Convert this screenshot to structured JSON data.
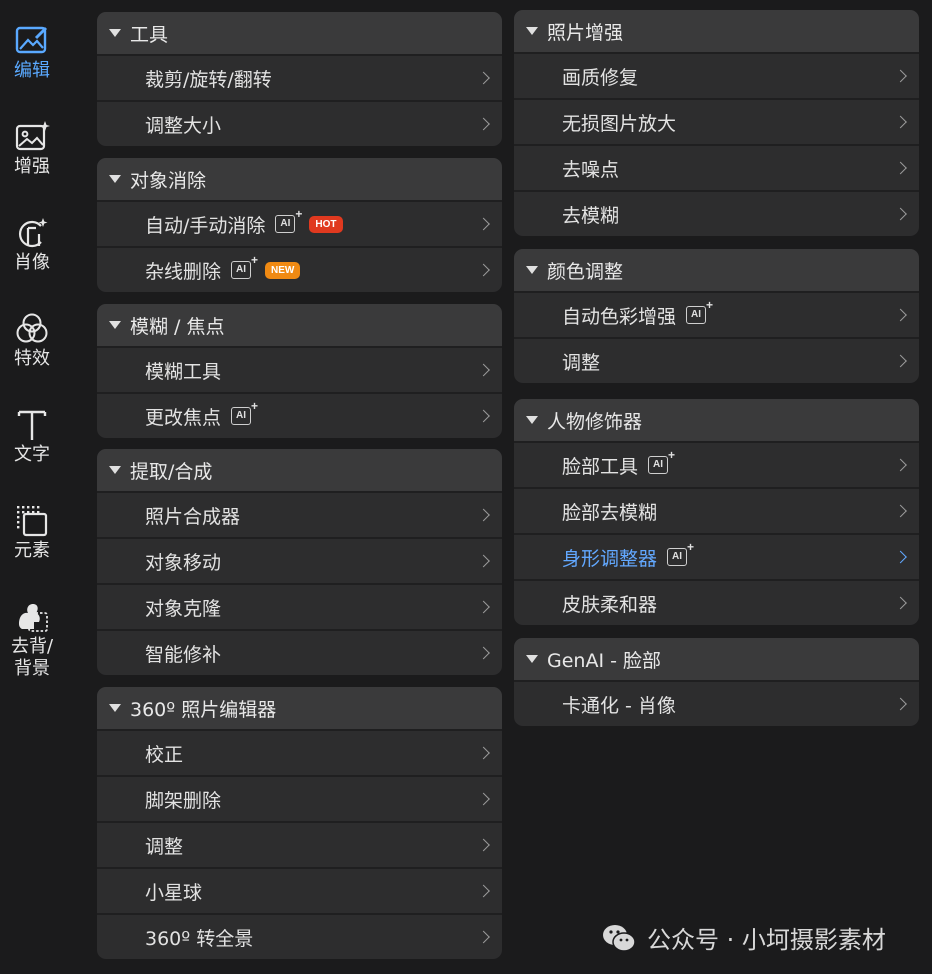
{
  "colors": {
    "accent": "#5aa9ff",
    "hot": "#e0391f",
    "new": "#f08a13"
  },
  "sidebar": {
    "items": [
      {
        "label": "编辑",
        "icon": "edit-image-icon",
        "active": true
      },
      {
        "label": "增强",
        "icon": "enhance-image-icon"
      },
      {
        "label": "肖像",
        "icon": "portrait-icon"
      },
      {
        "label": "特效",
        "icon": "effects-icon"
      },
      {
        "label": "文字",
        "icon": "text-icon"
      },
      {
        "label": "元素",
        "icon": "elements-icon"
      },
      {
        "label": "去背/\n背景",
        "icon": "remove-bg-icon"
      }
    ]
  },
  "panels": {
    "tools": {
      "title": "工具",
      "rows": [
        "裁剪/旋转/翻转",
        "调整大小"
      ]
    },
    "object_removal": {
      "title": "对象消除",
      "rows": [
        "自动/手动消除",
        "杂线删除"
      ],
      "badges": [
        "HOT",
        "NEW"
      ]
    },
    "blur_focus": {
      "title": "模糊 / 焦点",
      "rows": [
        "模糊工具",
        "更改焦点"
      ]
    },
    "extract": {
      "title": "提取/合成",
      "rows": [
        "照片合成器",
        "对象移动",
        "对象克隆",
        "智能修补"
      ]
    },
    "editor360": {
      "title": "360º 照片编辑器",
      "rows": [
        "校正",
        "脚架删除",
        "调整",
        "小星球",
        "360º 转全景"
      ]
    },
    "photo_enhance": {
      "title": "照片增强",
      "rows": [
        "画质修复",
        "无损图片放大",
        "去噪点",
        "去模糊"
      ]
    },
    "color_adjust": {
      "title": "颜色调整",
      "rows": [
        "自动色彩增强",
        "调整"
      ]
    },
    "retoucher": {
      "title": "人物修饰器",
      "rows": [
        "脸部工具",
        "脸部去模糊",
        "身形调整器",
        "皮肤柔和器"
      ]
    },
    "genai_face": {
      "title": "GenAI - 脸部",
      "rows": [
        "卡通化 - 肖像"
      ]
    }
  },
  "ai_label": "AI",
  "footer": {
    "text": "公众号 · 小坷摄影素材",
    "icon": "wechat-icon"
  }
}
